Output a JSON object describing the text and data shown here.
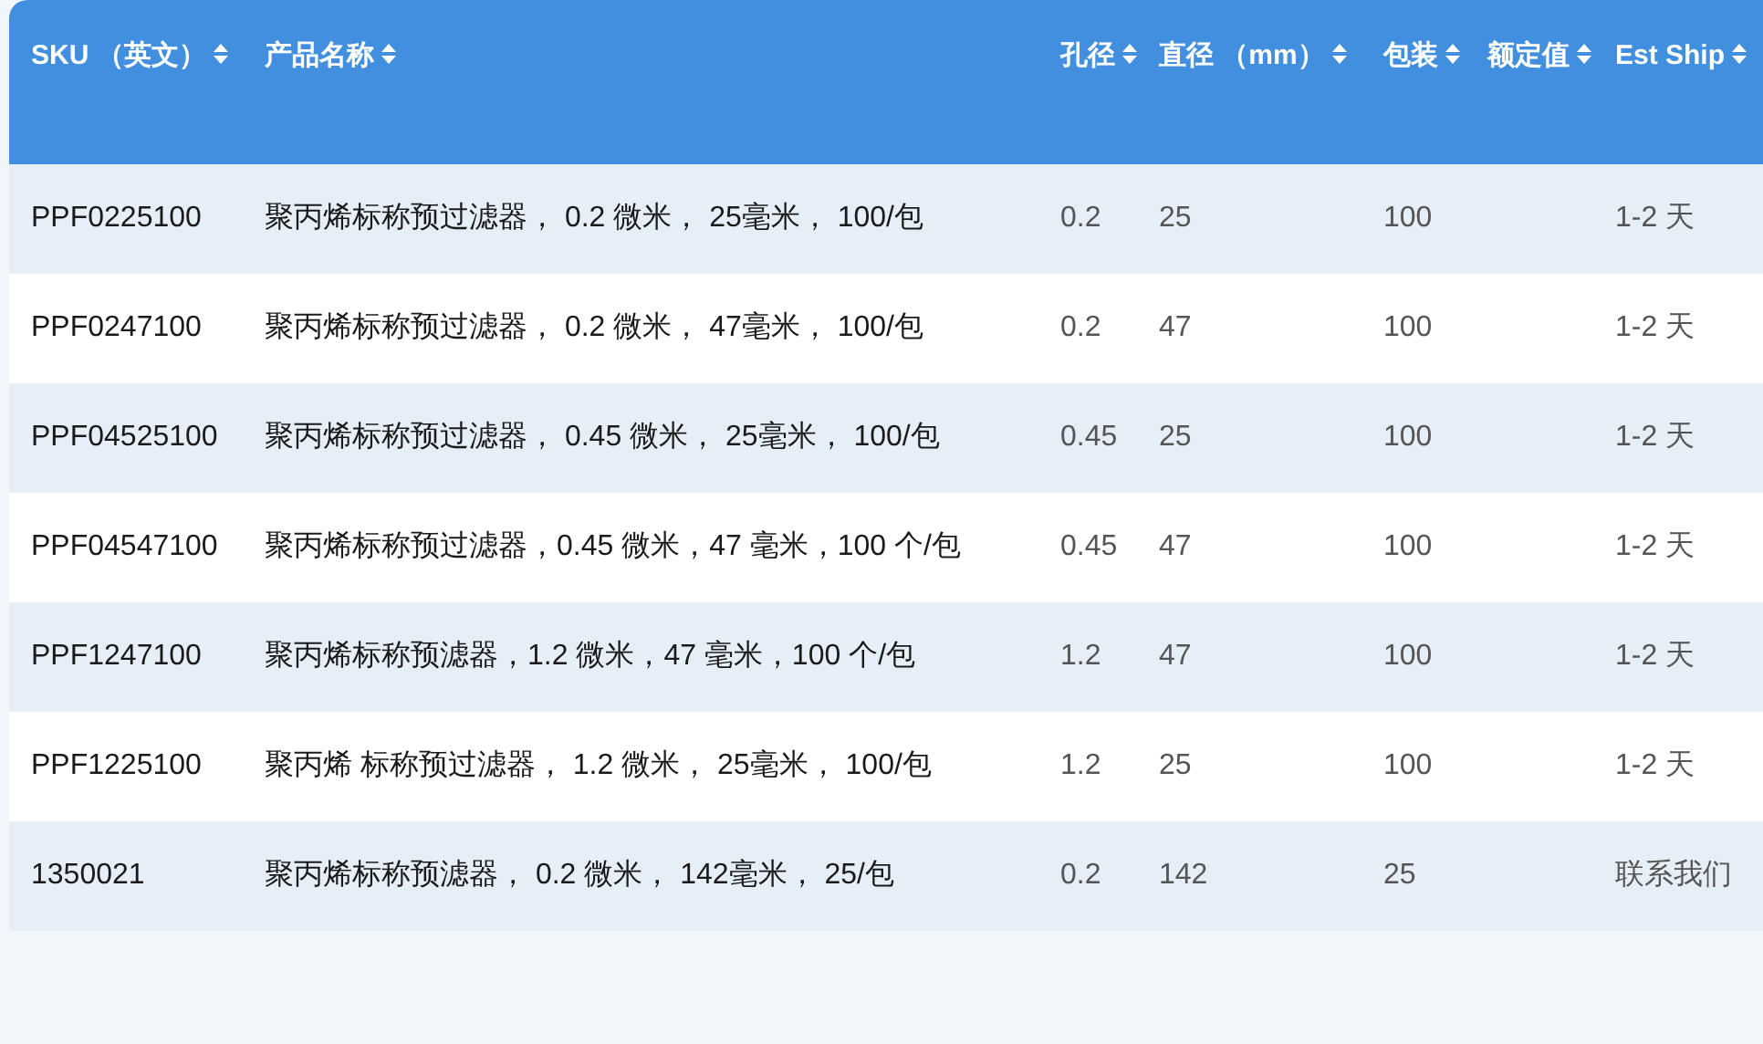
{
  "table": {
    "columns": [
      {
        "label": "SKU （英文）"
      },
      {
        "label": "产品名称"
      },
      {
        "label": "孔径"
      },
      {
        "label": "直径 （mm）"
      },
      {
        "label": "包装"
      },
      {
        "label": "额定值"
      },
      {
        "label": "Est Ship"
      }
    ],
    "rows": [
      {
        "sku": "PPF0225100",
        "name": "聚丙烯标称预过滤器， 0.2 微米， 25毫米， 100/包",
        "pore": "0.2",
        "diameter": "25",
        "pack": "100",
        "ship": "1-2 天"
      },
      {
        "sku": "PPF0247100",
        "name": "聚丙烯标称预过滤器， 0.2 微米， 47毫米， 100/包",
        "pore": "0.2",
        "diameter": "47",
        "pack": "100",
        "ship": "1-2 天"
      },
      {
        "sku": "PPF04525100",
        "name": "聚丙烯标称预过滤器， 0.45 微米， 25毫米， 100/包",
        "pore": "0.45",
        "diameter": "25",
        "pack": "100",
        "ship": "1-2 天"
      },
      {
        "sku": "PPF04547100",
        "name": "聚丙烯标称预过滤器，0.45 微米，47 毫米，100 个/包",
        "pore": "0.45",
        "diameter": "47",
        "pack": "100",
        "ship": "1-2 天"
      },
      {
        "sku": "PPF1247100",
        "name": "聚丙烯标称预滤器，1.2 微米，47 毫米，100 个/包",
        "pore": "1.2",
        "diameter": "47",
        "pack": "100",
        "ship": "1-2 天"
      },
      {
        "sku": "PPF1225100",
        "name": "聚丙烯 标称预过滤器， 1.2 微米， 25毫米， 100/包",
        "pore": "1.2",
        "diameter": "25",
        "pack": "100",
        "ship": "1-2 天"
      },
      {
        "sku": "1350021",
        "name": "聚丙烯标称预滤器， 0.2 微米， 142毫米， 25/包",
        "pore": "0.2",
        "diameter": "142",
        "pack": "25",
        "ship": "联系我们"
      }
    ]
  }
}
